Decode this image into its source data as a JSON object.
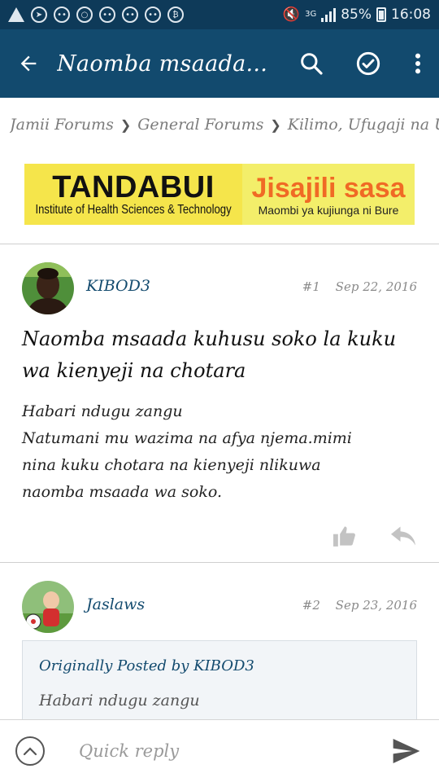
{
  "status_bar": {
    "network": "3G",
    "battery": "85%",
    "time": "16:08"
  },
  "app_bar": {
    "title": "Naomba msaada...",
    "icons": [
      "back-arrow-icon",
      "search-icon",
      "check-circle-icon",
      "more-vert-icon"
    ]
  },
  "breadcrumb": {
    "items": [
      "Jamii Forums",
      "General Forums",
      "Kilimo, Ufugaji na Uv"
    ]
  },
  "banner": {
    "brand": "TANDABUI",
    "subtitle": "Institute of Health Sciences & Technology",
    "cta": "Jisajili sasa",
    "note": "Maombi ya kujiunga ni Bure"
  },
  "posts": [
    {
      "username": "KIBOD3",
      "number": "#1",
      "date": "Sep 22, 2016",
      "title": "Naomba msaada kuhusu soko la kuku wa kienyeji na chotara",
      "body_lines": [
        "Habari ndugu zangu",
        "Natumani mu wazima na afya njema.mimi",
        "nina kuku chotara na kienyeji nlikuwa",
        "naomba msaada wa soko."
      ]
    },
    {
      "username": "Jaslaws",
      "number": "#2",
      "date": "Sep 23, 2016",
      "quote_by": "Originally Posted by KIBOD3",
      "quote_text": "Habari ndugu zangu"
    }
  ],
  "reply_bar": {
    "placeholder": "Quick reply"
  },
  "colors": {
    "status_bar": "#0e3a59",
    "app_bar": "#124a6e",
    "username": "#124a6e",
    "banner_yellow": "#f5e54b",
    "banner_orange": "#f06a25"
  }
}
